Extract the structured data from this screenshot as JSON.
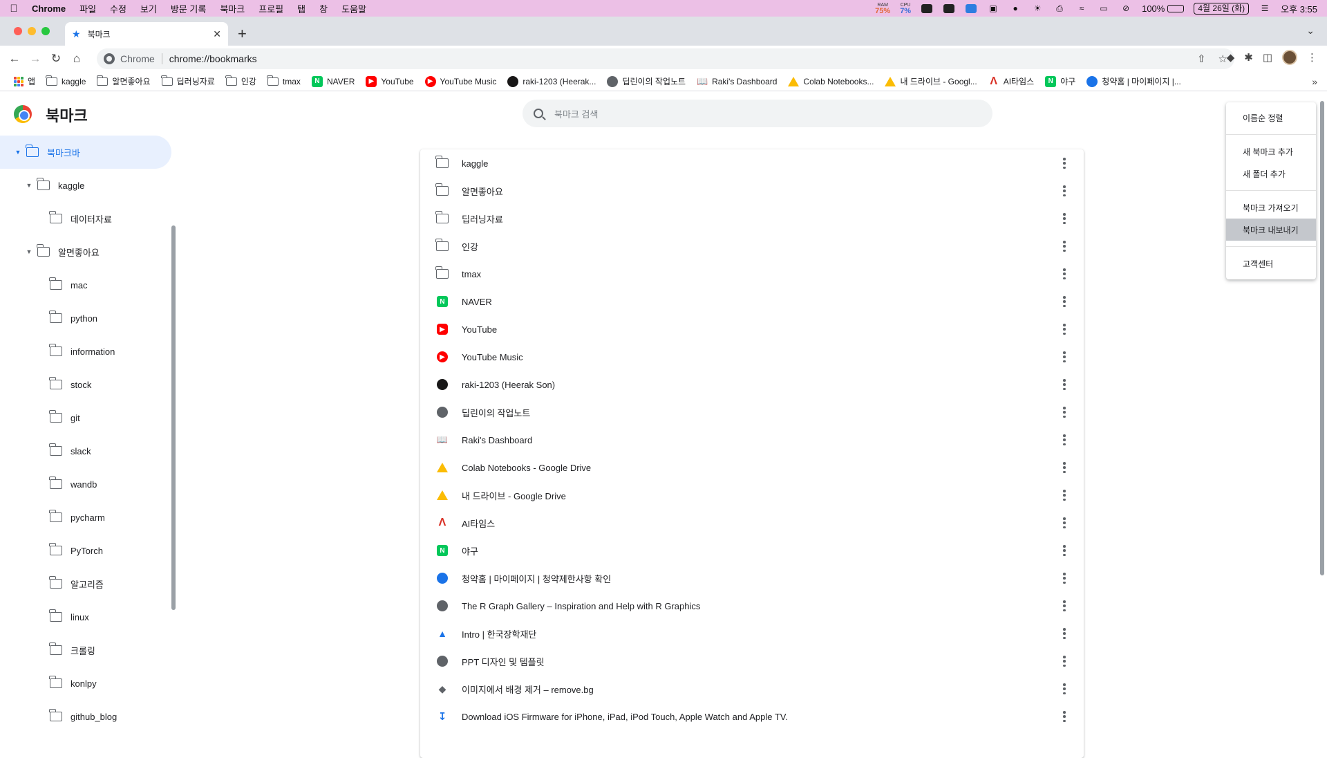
{
  "menubar": {
    "app": "Chrome",
    "items": [
      "파일",
      "수정",
      "보기",
      "방문 기록",
      "북마크",
      "프로필",
      "탭",
      "창",
      "도움말"
    ],
    "ram_label": "RAM",
    "ram_value": "75%",
    "cpu_label": "CPU",
    "cpu_value": "7%",
    "battery": "100%",
    "date": "4월 26일 (화)",
    "time": "오후 3:55"
  },
  "tab": {
    "title": "북마크"
  },
  "toolbar": {
    "site_label": "Chrome",
    "url": "chrome://bookmarks"
  },
  "bookmarks_bar": [
    {
      "label": "앱",
      "icon": "apps-icon"
    },
    {
      "label": "kaggle",
      "icon": "folder-icon"
    },
    {
      "label": "알면좋아요",
      "icon": "folder-icon"
    },
    {
      "label": "딥러닝자료",
      "icon": "folder-icon"
    },
    {
      "label": "인강",
      "icon": "folder-icon"
    },
    {
      "label": "tmax",
      "icon": "folder-icon"
    },
    {
      "label": "NAVER",
      "icon": "naver-icon"
    },
    {
      "label": "YouTube",
      "icon": "youtube-icon"
    },
    {
      "label": "YouTube Music",
      "icon": "youtube-music-icon"
    },
    {
      "label": "raki-1203 (Heerak...",
      "icon": "github-icon"
    },
    {
      "label": "딥린이의 작업노트",
      "icon": "globe-icon"
    },
    {
      "label": "Raki's Dashboard",
      "icon": "book-icon"
    },
    {
      "label": "Colab Notebooks...",
      "icon": "drive-icon"
    },
    {
      "label": "내 드라이브 - Googl...",
      "icon": "drive-icon"
    },
    {
      "label": "AI타임스",
      "icon": "aitimes-icon"
    },
    {
      "label": "야구",
      "icon": "naver-icon"
    },
    {
      "label": "청약홈 | 마이페이지 |...",
      "icon": "cheongyak-icon"
    }
  ],
  "page": {
    "title": "북마크",
    "search_placeholder": "북마크 검색"
  },
  "sidebar": [
    {
      "label": "북마크바",
      "level": 0,
      "expanded": true,
      "selected": true
    },
    {
      "label": "kaggle",
      "level": 1,
      "expanded": true
    },
    {
      "label": "데이터자료",
      "level": 2
    },
    {
      "label": "알면좋아요",
      "level": 1,
      "expanded": true
    },
    {
      "label": "mac",
      "level": 2
    },
    {
      "label": "python",
      "level": 2
    },
    {
      "label": "information",
      "level": 2
    },
    {
      "label": "stock",
      "level": 2
    },
    {
      "label": "git",
      "level": 2
    },
    {
      "label": "slack",
      "level": 2
    },
    {
      "label": "wandb",
      "level": 2
    },
    {
      "label": "pycharm",
      "level": 2
    },
    {
      "label": "PyTorch",
      "level": 2
    },
    {
      "label": "알고리즘",
      "level": 2
    },
    {
      "label": "linux",
      "level": 2
    },
    {
      "label": "크롤링",
      "level": 2
    },
    {
      "label": "konlpy",
      "level": 2
    },
    {
      "label": "github_blog",
      "level": 2
    }
  ],
  "items": [
    {
      "label": "kaggle",
      "icon": "folder-icon"
    },
    {
      "label": "알면좋아요",
      "icon": "folder-icon"
    },
    {
      "label": "딥러닝자료",
      "icon": "folder-icon"
    },
    {
      "label": "인강",
      "icon": "folder-icon"
    },
    {
      "label": "tmax",
      "icon": "folder-icon"
    },
    {
      "label": "NAVER",
      "icon": "naver-icon"
    },
    {
      "label": "YouTube",
      "icon": "youtube-icon"
    },
    {
      "label": "YouTube Music",
      "icon": "youtube-music-icon"
    },
    {
      "label": "raki-1203 (Heerak Son)",
      "icon": "github-icon"
    },
    {
      "label": "딥린이의 작업노트",
      "icon": "globe-icon"
    },
    {
      "label": "Raki's Dashboard",
      "icon": "book-icon"
    },
    {
      "label": "Colab Notebooks - Google Drive",
      "icon": "drive-icon"
    },
    {
      "label": "내 드라이브 - Google Drive",
      "icon": "drive-icon"
    },
    {
      "label": "AI타임스",
      "icon": "aitimes-icon"
    },
    {
      "label": "야구",
      "icon": "naver-icon"
    },
    {
      "label": "청약홈 | 마이페이지 | 청약제한사항 확인",
      "icon": "cheongyak-icon"
    },
    {
      "label": "The R Graph Gallery – Inspiration and Help with R Graphics",
      "icon": "globe-icon"
    },
    {
      "label": "Intro | 한국장학재단",
      "icon": "graduation-cap-icon"
    },
    {
      "label": "PPT 디자인 및 템플릿",
      "icon": "globe-icon"
    },
    {
      "label": "이미지에서 배경 제거 – remove.bg",
      "icon": "removebg-icon"
    },
    {
      "label": "Download iOS Firmware for iPhone, iPad, iPod Touch, Apple Watch and Apple TV.",
      "icon": "download-icon"
    }
  ],
  "menu": {
    "sort": "이름순 정렬",
    "add_bookmark": "새 북마크 추가",
    "add_folder": "새 폴더 추가",
    "import": "북마크 가져오기",
    "export": "북마크 내보내기",
    "help": "고객센터"
  }
}
